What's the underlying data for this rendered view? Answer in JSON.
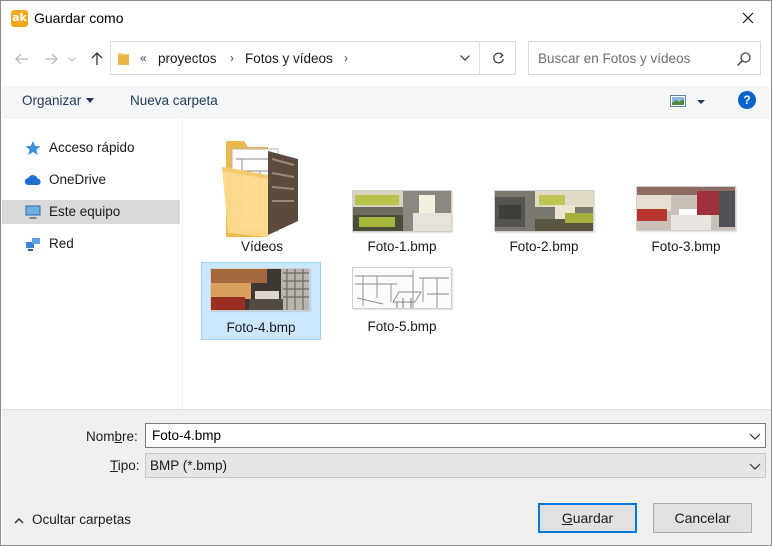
{
  "window": {
    "app_icon_text": "ak",
    "title": "Guardar como"
  },
  "address": {
    "overflow": "«",
    "crumbs": [
      "proyectos",
      "Fotos y vídeos"
    ],
    "separator": "›"
  },
  "search": {
    "placeholder": "Buscar en Fotos y vídeos"
  },
  "toolbar": {
    "organize_label": "Organizar",
    "new_folder_label": "Nueva carpeta",
    "help_label": "?"
  },
  "sidebar": {
    "items": [
      {
        "label": "Acceso rápido",
        "icon": "star-icon"
      },
      {
        "label": "OneDrive",
        "icon": "cloud-icon"
      },
      {
        "label": "Este equipo",
        "icon": "computer-icon",
        "selected": true
      },
      {
        "label": "Red",
        "icon": "network-icon"
      }
    ]
  },
  "files": [
    {
      "name": "Vídeos",
      "kind": "folder"
    },
    {
      "name": "Foto-1.bmp",
      "kind": "image"
    },
    {
      "name": "Foto-2.bmp",
      "kind": "image"
    },
    {
      "name": "Foto-3.bmp",
      "kind": "image"
    },
    {
      "name": "Foto-4.bmp",
      "kind": "image",
      "selected": true
    },
    {
      "name": "Foto-5.bmp",
      "kind": "image"
    }
  ],
  "form": {
    "name_label_pre": "Nom",
    "name_label_u": "b",
    "name_label_post": "re:",
    "name_value": "Foto-4.bmp",
    "type_label_u": "T",
    "type_label_post": "ipo:",
    "type_value": "BMP (*.bmp)"
  },
  "footer": {
    "hide_folders_label": "Ocultar carpetas",
    "save_label_u": "G",
    "save_label_post": "uardar",
    "cancel_label": "Cancelar"
  },
  "colors": {
    "accent": "#0078d7",
    "selection": "#cce8ff",
    "help": "#0a63c9",
    "folder": "#f7d06b",
    "app_icon": "#f2a81d"
  }
}
